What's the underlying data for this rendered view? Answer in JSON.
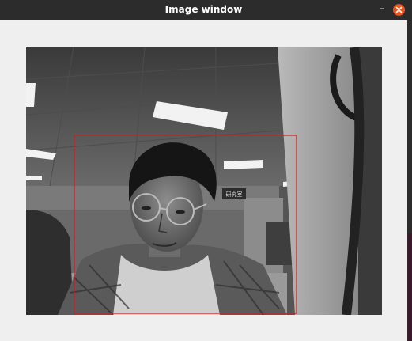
{
  "window": {
    "title": "Image window"
  },
  "titlebar": {
    "minimize_glyph": "–",
    "minimize_icon": "minimize-icon",
    "close_icon": "close-icon",
    "close_color": "#e95420"
  },
  "image_view": {
    "description_icon": "camera-frame",
    "detection_box_color": "#cc2020",
    "sign_text": "研究室"
  }
}
